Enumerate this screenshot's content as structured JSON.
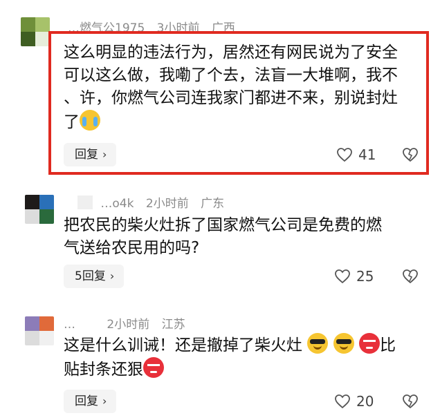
{
  "comments": [
    {
      "username": "…燃气公1975",
      "time": "3小时前",
      "location": "广西",
      "lines": [
        "这么明显的违法行为，居然还有网民说为了安全",
        "可以这么做，我嘞了个去，法盲一大堆啊，我不",
        "、许，你燃气公司连我家门都进不来，别说封灶",
        "了"
      ],
      "reply_label": "回复",
      "likes": "41",
      "avatar_colors": [
        "#6f8f3a",
        "#a7c26a",
        "#3f5e22",
        "#e7eedb"
      ]
    },
    {
      "username": "…o4k",
      "time": "2小时前",
      "location": "广东",
      "lines": [
        "把农民的柴火灶拆了国家燃气公司是免费的燃",
        "气送给农民用的吗?"
      ],
      "reply_label": "5回复",
      "likes": "25",
      "avatar_colors": [
        "#1e1b1a",
        "#2a70b8",
        "#dcdcdc",
        "#2a6a3c"
      ]
    },
    {
      "username": "…",
      "time": "2小时前",
      "location": "江苏",
      "lines": [
        "这是什么训诫！还是撤掉了柴火灶",
        "贴封条还狠"
      ],
      "line1_tail": "比",
      "reply_label": "回复",
      "likes": "20",
      "avatar_colors": [
        "#8c7cb8",
        "#e06a3a",
        "#dcdcdc",
        "#f0f0f0"
      ]
    }
  ],
  "icons": {
    "like": "heart-outline-icon",
    "dislike": "broken-heart-icon",
    "reply_chevron": "chevron-right-icon"
  },
  "colors": {
    "highlight_border": "#e02a20",
    "meta_text": "#8a8a8a"
  }
}
